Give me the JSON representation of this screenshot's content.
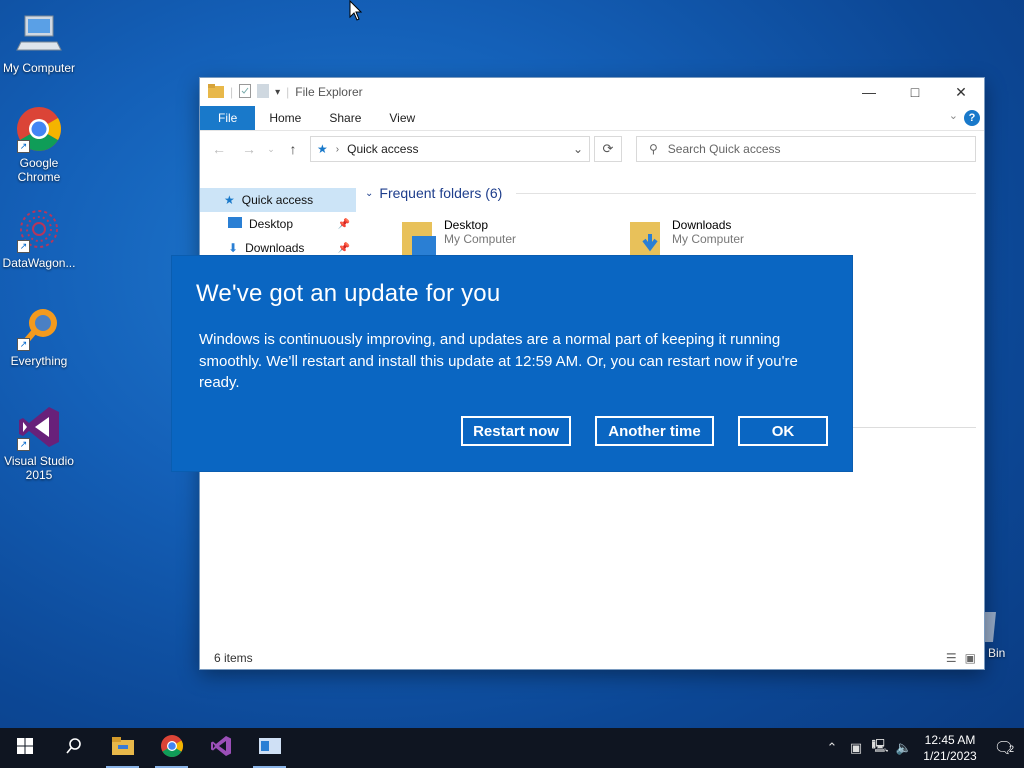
{
  "desktop": {
    "icons": [
      {
        "label": "My Computer"
      },
      {
        "label": "Google Chrome"
      },
      {
        "label": "DataWagon..."
      },
      {
        "label": "Everything"
      },
      {
        "label": "Visual Studio 2015"
      }
    ],
    "recycle_label": "Bin"
  },
  "explorer": {
    "title": "File Explorer",
    "ribbon_tabs": [
      "File",
      "Home",
      "Share",
      "View"
    ],
    "address": "Quick access",
    "search_placeholder": "Search Quick access",
    "nav_items": [
      {
        "label": "Quick access"
      },
      {
        "label": "Desktop"
      },
      {
        "label": "Downloads"
      }
    ],
    "group_header": "Frequent folders (6)",
    "folders": [
      {
        "name": "Desktop",
        "location": "My Computer"
      },
      {
        "name": "Downloads",
        "location": "My Computer"
      }
    ],
    "status": "6 items"
  },
  "dialog": {
    "title": "We've got an update for you",
    "body": "Windows is continuously improving, and updates are a normal part of keeping it running smoothly. We'll restart and install this update at 12:59 AM. Or, you can restart now if you're ready.",
    "buttons": {
      "restart": "Restart now",
      "another": "Another time",
      "ok": "OK"
    }
  },
  "taskbar": {
    "time": "12:45 AM",
    "date": "1/21/2023",
    "notification_count": "2"
  },
  "colors": {
    "dialog_bg": "#0a66c2",
    "desktop_bg": "#1460b8",
    "taskbar_bg": "#0f1521",
    "accent": "#1979ca"
  }
}
